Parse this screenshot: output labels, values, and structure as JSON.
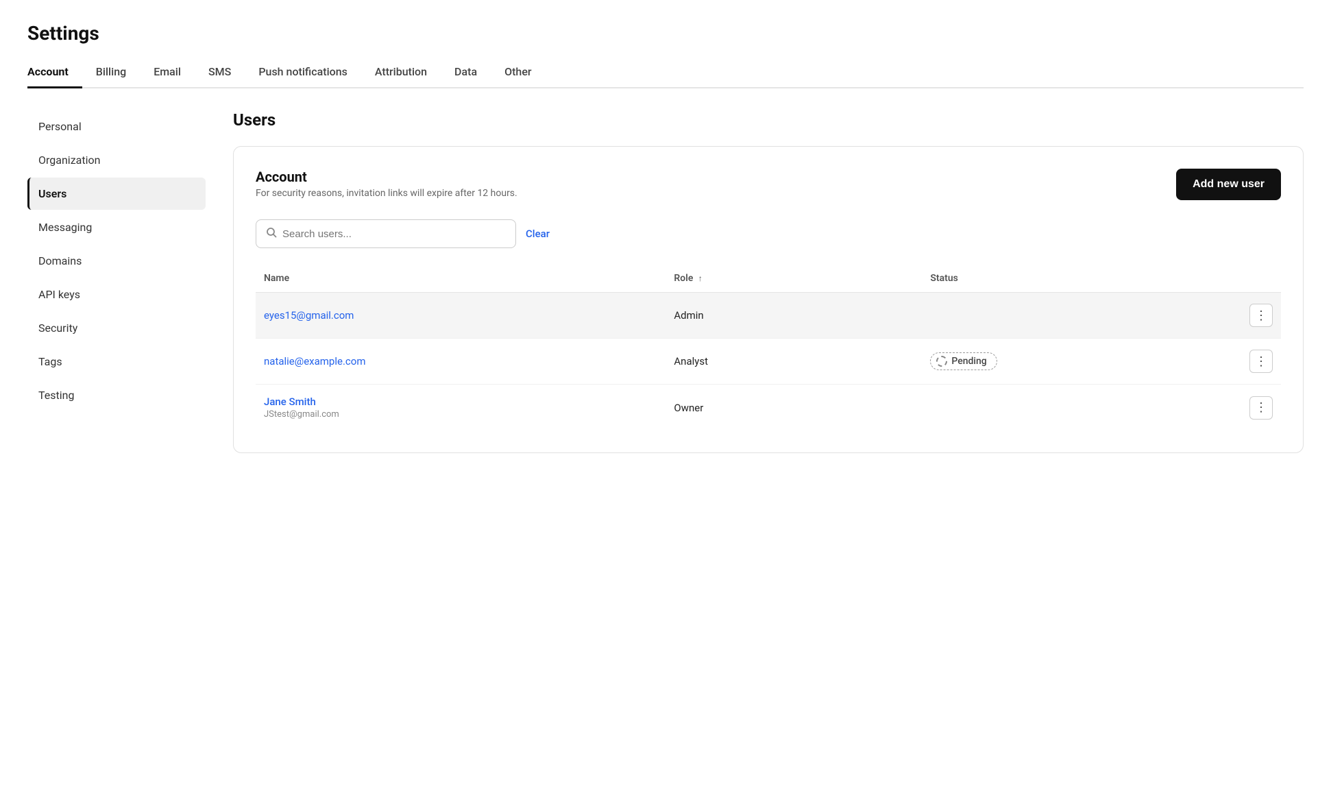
{
  "page": {
    "title": "Settings"
  },
  "topTabs": [
    {
      "id": "account",
      "label": "Account",
      "active": true
    },
    {
      "id": "billing",
      "label": "Billing",
      "active": false
    },
    {
      "id": "email",
      "label": "Email",
      "active": false
    },
    {
      "id": "sms",
      "label": "SMS",
      "active": false
    },
    {
      "id": "push",
      "label": "Push notifications",
      "active": false
    },
    {
      "id": "attribution",
      "label": "Attribution",
      "active": false
    },
    {
      "id": "data",
      "label": "Data",
      "active": false
    },
    {
      "id": "other",
      "label": "Other",
      "active": false
    }
  ],
  "sidebar": {
    "items": [
      {
        "id": "personal",
        "label": "Personal",
        "active": false
      },
      {
        "id": "organization",
        "label": "Organization",
        "active": false
      },
      {
        "id": "users",
        "label": "Users",
        "active": true
      },
      {
        "id": "messaging",
        "label": "Messaging",
        "active": false
      },
      {
        "id": "domains",
        "label": "Domains",
        "active": false
      },
      {
        "id": "api-keys",
        "label": "API keys",
        "active": false
      },
      {
        "id": "security",
        "label": "Security",
        "active": false
      },
      {
        "id": "tags",
        "label": "Tags",
        "active": false
      },
      {
        "id": "testing",
        "label": "Testing",
        "active": false
      }
    ]
  },
  "content": {
    "title": "Users",
    "card": {
      "accountTitle": "Account",
      "accountDesc": "For security reasons, invitation links will expire after 12 hours.",
      "addUserBtn": "Add new user",
      "search": {
        "placeholder": "Search users...",
        "clearLabel": "Clear"
      },
      "table": {
        "columns": [
          {
            "id": "name",
            "label": "Name"
          },
          {
            "id": "role",
            "label": "Role",
            "sortable": true,
            "sortArrow": "↑"
          },
          {
            "id": "status",
            "label": "Status"
          }
        ],
        "rows": [
          {
            "id": "row1",
            "name": "eyes15@gmail.com",
            "nameType": "email",
            "subtext": "",
            "role": "Admin",
            "status": "",
            "highlighted": true
          },
          {
            "id": "row2",
            "name": "natalie@example.com",
            "nameType": "email",
            "subtext": "",
            "role": "Analyst",
            "status": "Pending",
            "highlighted": false
          },
          {
            "id": "row3",
            "name": "Jane Smith",
            "nameType": "name",
            "subtext": "JStest@gmail.com",
            "role": "Owner",
            "status": "",
            "highlighted": false
          }
        ]
      }
    }
  }
}
